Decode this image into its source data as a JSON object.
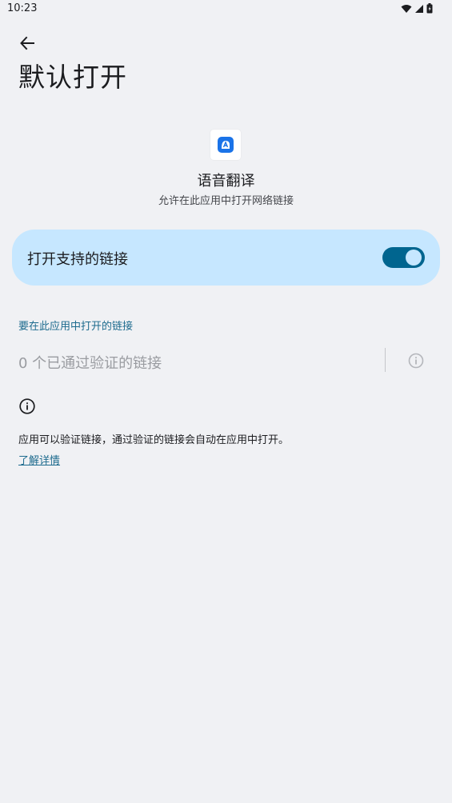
{
  "status_bar": {
    "time": "10:23"
  },
  "header": {
    "back_icon": "arrow-left-icon",
    "title": "默认打开"
  },
  "app": {
    "icon": "translate-app-icon",
    "icon_color": "#1a73e8",
    "name": "语音翻译",
    "subtitle": "允许在此应用中打开网络链接"
  },
  "toggle": {
    "label": "打开支持的链接",
    "enabled": true,
    "track_color": "#00658f",
    "card_color": "#c6e7ff"
  },
  "links_section": {
    "header": "要在此应用中打开的链接",
    "verified_label": "0 个已通过验证的链接",
    "info_icon": "info-icon"
  },
  "info": {
    "icon": "info-icon",
    "text": "应用可以验证链接，通过验证的链接会自动在应用中打开。",
    "learn_more": "了解详情"
  },
  "colors": {
    "background": "#f0f1f4",
    "accent": "#1d6b8e"
  }
}
